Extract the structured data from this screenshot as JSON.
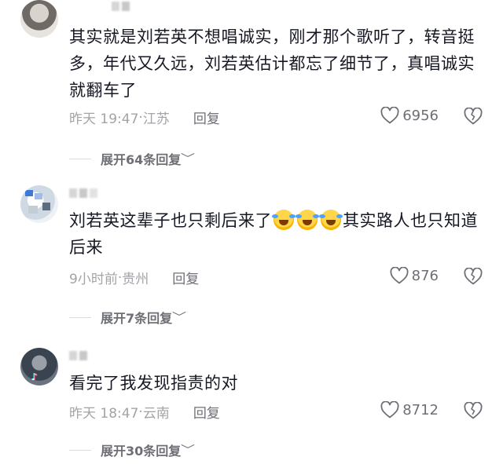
{
  "comments": [
    {
      "text": "其实就是刘若英不想唱诚实，刚才那个歌听了，转音挺多，年代又久远，刘若英估计都忘了细节了，真唱诚实就翻车了",
      "time": "昨天 19:47",
      "location": "江苏",
      "reply_label": "回复",
      "likes": "6956",
      "expand_label": "展开64条回复"
    },
    {
      "text_before_emoji": "刘若英这辈子也只剩后来了",
      "emoji_count": 3,
      "text_after_emoji": "其实路人也只知道后来",
      "time": "9小时前",
      "location": "贵州",
      "reply_label": "回复",
      "likes": "876",
      "expand_label": "展开7条回复"
    },
    {
      "text": "看完了我发现指责的对",
      "time": "昨天 18:47",
      "location": "云南",
      "reply_label": "回复",
      "likes": "8712",
      "expand_label": "展开30条回复"
    }
  ],
  "icons": {
    "like": "heart-outline-icon",
    "dislike": "broken-heart-icon",
    "expand": "chevron-down-icon",
    "badge": "tiktok-logo-icon"
  },
  "colors": {
    "text": "#161823",
    "meta": "#a3a3a8",
    "secondary": "#6e6f76"
  }
}
